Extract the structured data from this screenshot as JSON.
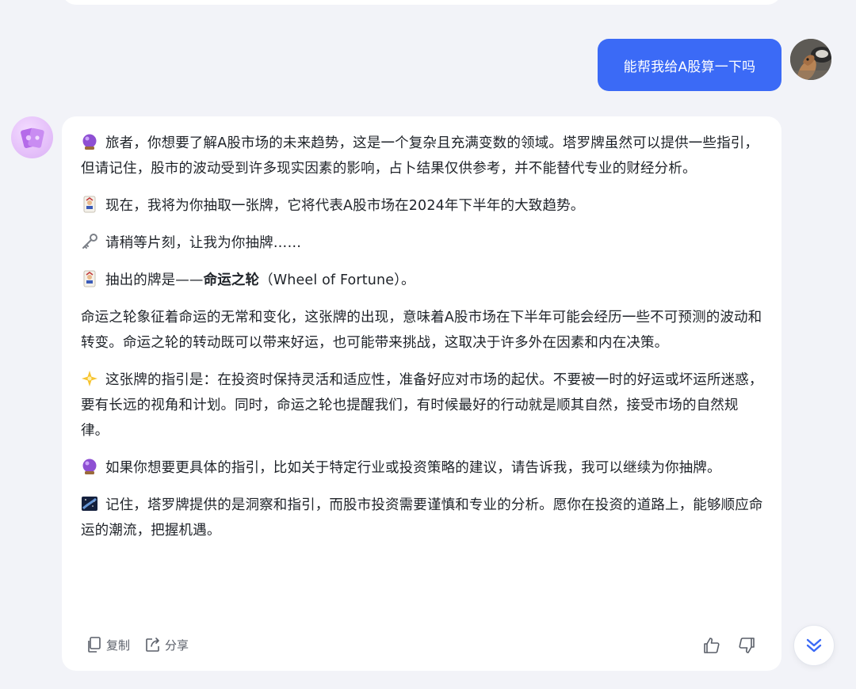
{
  "colors": {
    "background": "#f2f3f8",
    "accent": "#3b6af6",
    "card": "#ffffff",
    "text": "#1f2329",
    "muted": "#5a5f69"
  },
  "user_message": {
    "text": "能帮我给A股算一下吗",
    "avatar_icon": "user-avatar-photo"
  },
  "bot_message": {
    "avatar_icon": "tarot-cards-icon",
    "paragraphs": [
      {
        "icon": "crystal-ball-icon",
        "text": "旅者，你想要了解A股市场的未来趋势，这是一个复杂且充满变数的领域。塔罗牌虽然可以提供一些指引，但请记住，股市的波动受到许多现实因素的影响，占卜结果仅供参考，并不能替代专业的财经分析。"
      },
      {
        "icon": "joker-card-icon",
        "text": "现在，我将为你抽取一张牌，它将代表A股市场在2024年下半年的大致趋势。"
      },
      {
        "icon": "key-icon",
        "text": "请稍等片刻，让我为你抽牌……"
      },
      {
        "icon": "joker-card-icon",
        "text_before": "抽出的牌是——",
        "text_bold": "命运之轮",
        "text_after": "（Wheel of Fortune）。"
      },
      {
        "icon": "",
        "text": "命运之轮象征着命运的无常和变化，这张牌的出现，意味着A股市场在下半年可能会经历一些不可预测的波动和转变。命运之轮的转动既可以带来好运，也可能带来挑战，这取决于许多外在因素和内在决策。"
      },
      {
        "icon": "sparkle-star-icon",
        "text": "这张牌的指引是：在投资时保持灵活和适应性，准备好应对市场的起伏。不要被一时的好运或坏运所迷惑，要有长远的视角和计划。同时，命运之轮也提醒我们，有时候最好的行动就是顺其自然，接受市场的自然规律。"
      },
      {
        "icon": "crystal-ball-icon",
        "text": "如果你想要更具体的指引，比如关于特定行业或投资策略的建议，请告诉我，我可以继续为你抽牌。"
      },
      {
        "icon": "milky-way-icon",
        "text": "记住，塔罗牌提供的是洞察和指引，而股市投资需要谨慎和专业的分析。愿你在投资的道路上，能够顺应命运的潮流，把握机遇。"
      }
    ]
  },
  "actions": {
    "copy_label": "复制",
    "share_label": "分享",
    "like_icon": "thumbs-up-icon",
    "dislike_icon": "thumbs-down-icon"
  },
  "scroll_down_icon": "double-chevron-down-icon"
}
